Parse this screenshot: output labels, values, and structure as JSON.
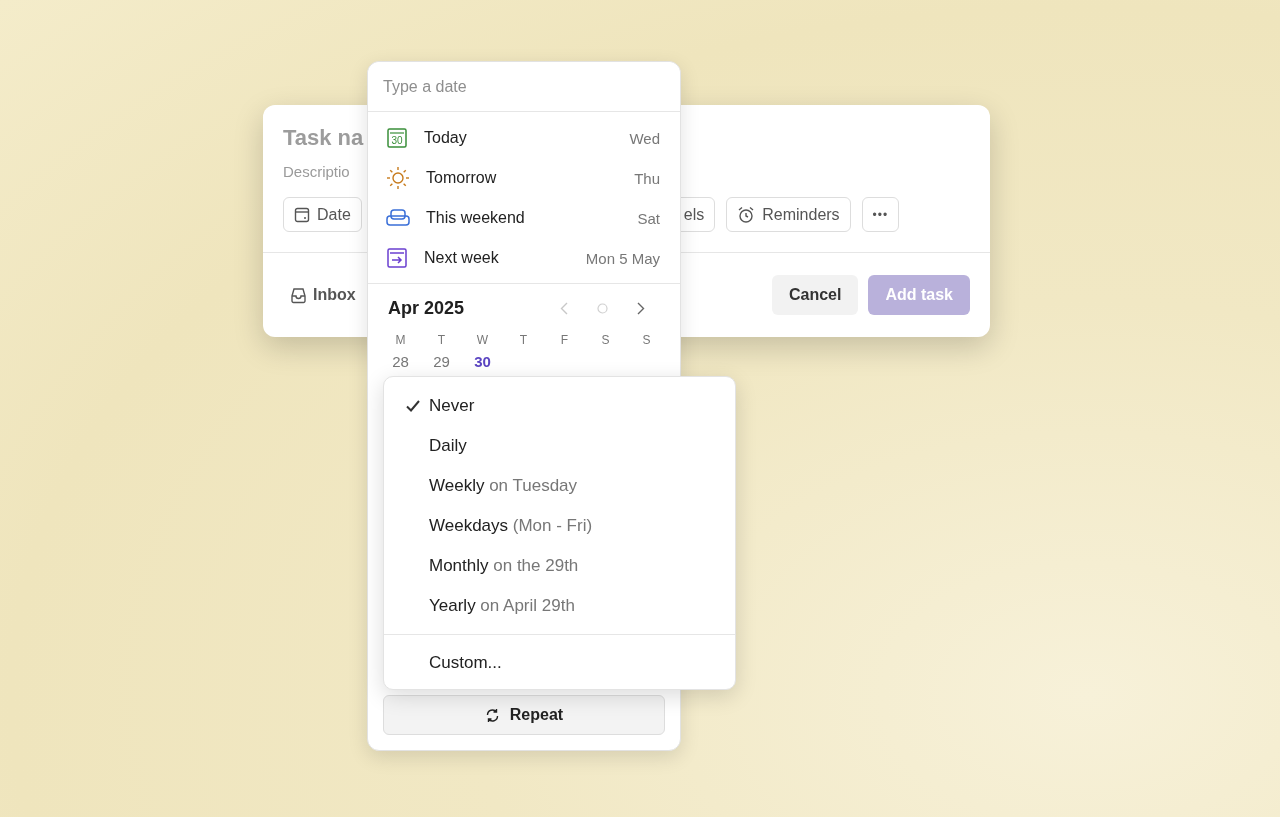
{
  "task_form": {
    "name_placeholder": "Task na",
    "description_placeholder": "Descriptio",
    "chips": [
      {
        "kind": "date",
        "label": "Date"
      },
      {
        "kind": "partial",
        "label": "els"
      },
      {
        "kind": "reminders",
        "label": "Reminders"
      },
      {
        "kind": "more",
        "label": "•••"
      }
    ],
    "project": "Inbox",
    "buttons": [
      {
        "kind": "cancel",
        "label": "Cancel"
      },
      {
        "kind": "submit",
        "label": "Add task",
        "disabled": true
      }
    ]
  },
  "date_picker": {
    "placeholder": "Type a date",
    "options": [
      {
        "kind": "today",
        "label": "Today",
        "badge": "30",
        "day": "Wed"
      },
      {
        "kind": "tomorrow",
        "label": "Tomorrow",
        "day": "Thu"
      },
      {
        "kind": "weekend",
        "label": "This weekend",
        "day": "Sat"
      },
      {
        "kind": "next_week",
        "label": "Next week",
        "day": "Mon 5 May"
      }
    ],
    "month": "Apr 2025",
    "weekdays": [
      "M",
      "T",
      "W",
      "T",
      "F",
      "S",
      "S"
    ],
    "days": [
      {
        "label": "28",
        "selected": false
      },
      {
        "label": "29",
        "selected": false
      },
      {
        "label": "30",
        "selected": true
      }
    ],
    "repeat_button": "Repeat"
  },
  "repeat_menu": {
    "items": [
      {
        "label": "Never",
        "checked": true
      },
      {
        "label": "Daily",
        "checked": false
      },
      {
        "label": "Weekly",
        "detail": "on Tuesday",
        "checked": false
      },
      {
        "label": "Weekdays",
        "detail": "(Mon - Fri)",
        "checked": false
      },
      {
        "label": "Monthly",
        "detail": "on the 29th",
        "checked": false
      },
      {
        "label": "Yearly",
        "detail": "on April 29th",
        "checked": false
      }
    ],
    "custom": "Custom..."
  }
}
